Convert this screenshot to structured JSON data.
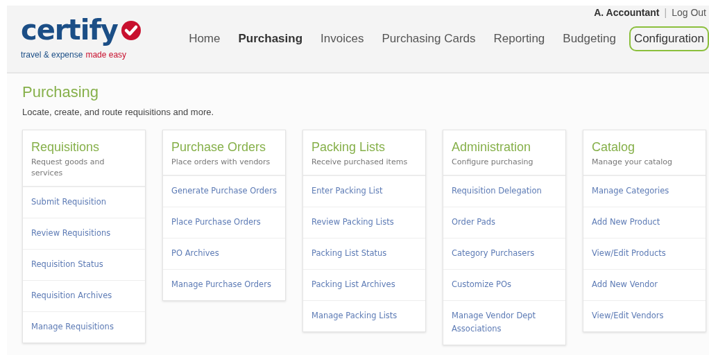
{
  "header": {
    "logo": {
      "wordmark": "certify",
      "tagline": [
        "travel & expense",
        "made easy"
      ]
    },
    "user": {
      "name": "A. Accountant",
      "separator": "|",
      "logout": "Log Out"
    },
    "nav": [
      {
        "label": "Home",
        "selected": false,
        "highlighted": false
      },
      {
        "label": "Purchasing",
        "selected": true,
        "highlighted": false
      },
      {
        "label": "Invoices",
        "selected": false,
        "highlighted": false
      },
      {
        "label": "Purchasing Cards",
        "selected": false,
        "highlighted": false
      },
      {
        "label": "Reporting",
        "selected": false,
        "highlighted": false
      },
      {
        "label": "Budgeting",
        "selected": false,
        "highlighted": false
      },
      {
        "label": "Configuration",
        "selected": false,
        "highlighted": true
      }
    ]
  },
  "page": {
    "title": "Purchasing",
    "subtitle": "Locate, create, and route requisitions and more."
  },
  "cards": [
    {
      "title": "Requisitions",
      "description": "Request goods and services",
      "links": [
        "Submit Requisition",
        "Review Requisitions",
        "Requisition Status",
        "Requisition Archives",
        "Manage Requisitions"
      ]
    },
    {
      "title": "Purchase Orders",
      "description": "Place orders with vendors",
      "links": [
        "Generate Purchase Orders",
        "Place Purchase Orders",
        "PO Archives",
        "Manage Purchase Orders"
      ]
    },
    {
      "title": "Packing Lists",
      "description": "Receive purchased items",
      "links": [
        "Enter Packing List",
        "Review Packing Lists",
        "Packing List Status",
        "Packing List Archives",
        "Manage Packing Lists"
      ]
    },
    {
      "title": "Administration",
      "description": "Configure purchasing",
      "links": [
        "Requisition Delegation",
        "Order Pads",
        "Category Purchasers",
        "Customize POs",
        "Manage Vendor Dept Associations"
      ]
    },
    {
      "title": "Catalog",
      "description": "Manage your catalog",
      "links": [
        "Manage Categories",
        "Add New Product",
        "View/Edit Products",
        "Add New Vendor",
        "View/Edit Vendors"
      ]
    }
  ]
}
